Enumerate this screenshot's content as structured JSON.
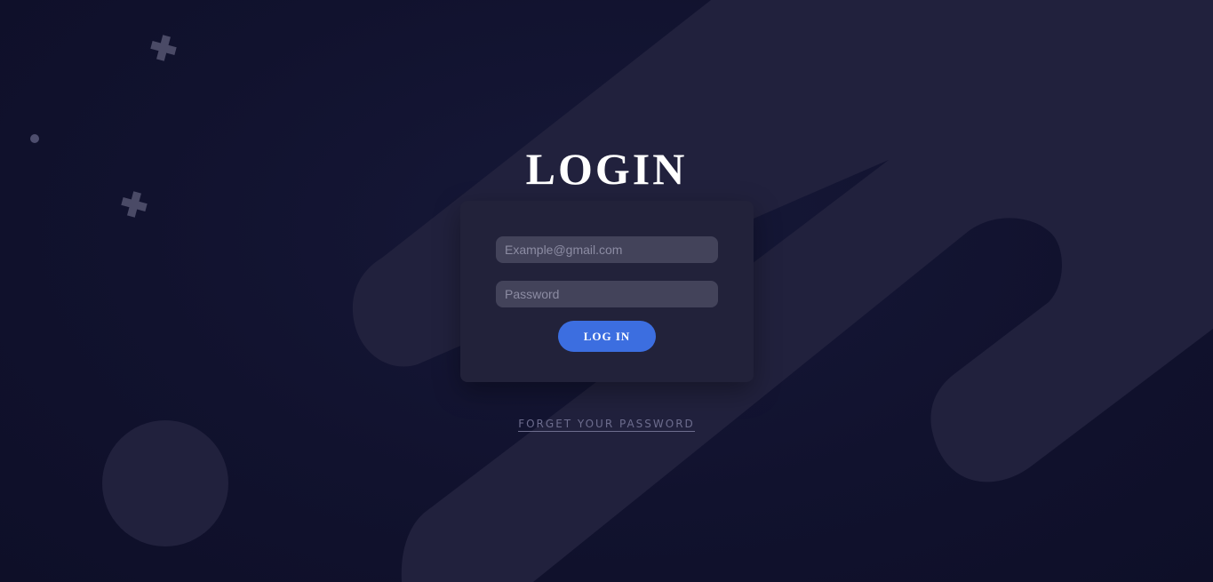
{
  "page": {
    "title": "LOGIN"
  },
  "form": {
    "email_placeholder": "Example@gmail.com",
    "email_value": "",
    "password_placeholder": "Password",
    "password_value": "",
    "submit_label": "LOG IN"
  },
  "links": {
    "forgot_password": "FORGET YOUR PASSWORD"
  },
  "colors": {
    "background": "#10112b",
    "card": "#22223a",
    "accent": "#3c6ee0",
    "decor": "#21213d"
  },
  "decorations": [
    "plus-icon",
    "plus-icon",
    "dot-icon",
    "circle-shape",
    "pill-shape",
    "pill-shape",
    "pill-shape"
  ]
}
